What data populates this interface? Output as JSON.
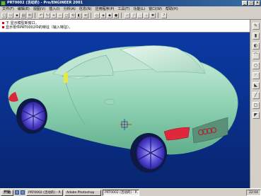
{
  "window": {
    "title": "PRT0002 (活动的) - Pro/ENGINEER 2001",
    "buttons": [
      "_",
      "□",
      "×"
    ]
  },
  "menu": [
    "文件(F)",
    "编辑(E)",
    "视图(V)",
    "插入(I)",
    "分析(A)",
    "信息(N)",
    "应用程序(P)",
    "工具(T)",
    "功能(L)",
    "窗口(W)",
    "帮助(H)"
  ],
  "toolbar_icons": [
    "new-icon",
    "open-icon",
    "save-icon",
    "print-icon",
    "email-icon",
    "undo-icon",
    "repaint-icon",
    "zoom-in-icon",
    "zoom-out-icon",
    "fit-icon",
    "orient-icon",
    "saved-views-icon",
    "layers-icon",
    "wireframe-icon",
    "hidden-line-icon",
    "no-hidden-icon",
    "shading-icon",
    "datum-planes-icon",
    "datum-axes-icon",
    "datum-points-icon",
    "coord-sys-icon",
    "spin-center-icon",
    "help-icon"
  ],
  "messages": [
    "下 显示模型新窗口。",
    "显示零件PRT0002中的特征（输入特征）。"
  ],
  "right_tools": [
    "sketch-icon",
    "extrude-icon",
    "revolve-icon",
    "blend-icon",
    "hole-icon",
    "round-icon",
    "chamfer-icon",
    "rib-icon",
    "shell-icon",
    "draft-icon"
  ],
  "taskbar": {
    "start": "开始",
    "tasks": [
      "PRT0002 (活动的) - P...",
      "Adobe Photoshop",
      "PRT0002 (活动的) - P..."
    ],
    "clock": "22:04"
  }
}
